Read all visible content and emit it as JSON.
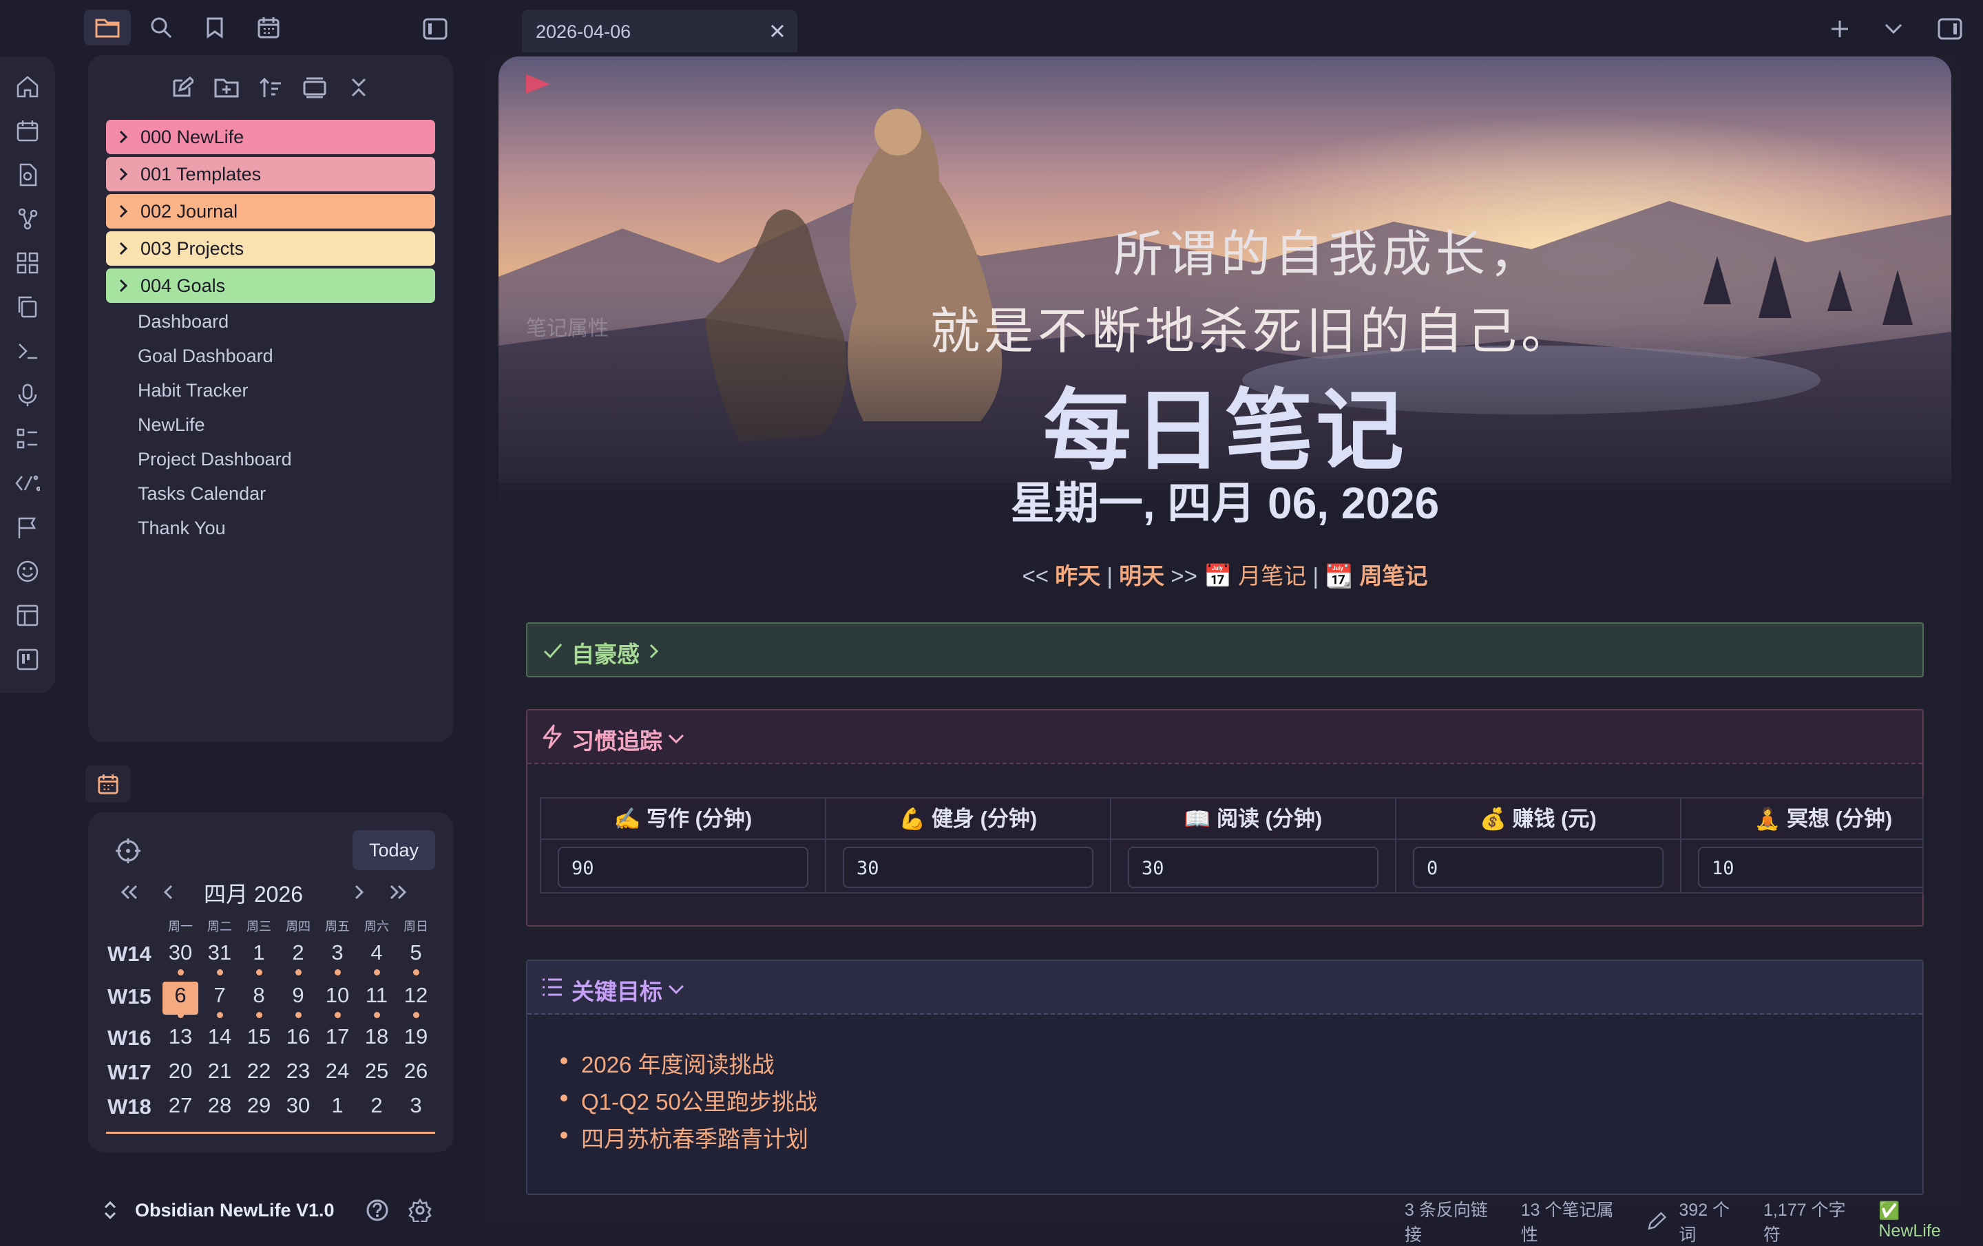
{
  "app": {
    "accent": "#f5a97f",
    "background": "#1d1d2e"
  },
  "tab": {
    "title": "2026-04-06"
  },
  "ribbon": {
    "icons": [
      "home-icon",
      "calendar-icon",
      "search-doc-icon",
      "graph-icon",
      "grid-icon",
      "copy-icon",
      "terminal-icon",
      "mic-icon",
      "list-icon",
      "templater-icon",
      "flag-icon",
      "smile-icon",
      "layout-icon",
      "kanban-icon"
    ]
  },
  "explorer": {
    "folders": [
      {
        "label": "000 NewLife",
        "color": "#f38ba8"
      },
      {
        "label": "001 Templates",
        "color": "#eba0ac"
      },
      {
        "label": "002 Journal",
        "color": "#fab387"
      },
      {
        "label": "003 Projects",
        "color": "#f9e2af"
      },
      {
        "label": "004 Goals",
        "color": "#a6e3a1"
      }
    ],
    "files": [
      "Dashboard",
      "Goal Dashboard",
      "Habit Tracker",
      "NewLife",
      "Project Dashboard",
      "Tasks Calendar",
      "Thank You"
    ]
  },
  "calendar": {
    "today_label": "Today",
    "month_title": "四月 2026",
    "weekdays": [
      "周一",
      "周二",
      "周三",
      "周四",
      "周五",
      "周六",
      "周日"
    ],
    "weeks": [
      {
        "label": "W14",
        "days": [
          "30",
          "31",
          "1",
          "2",
          "3",
          "4",
          "5"
        ]
      },
      {
        "label": "W15",
        "days": [
          "6",
          "7",
          "8",
          "9",
          "10",
          "11",
          "12"
        ]
      },
      {
        "label": "W16",
        "days": [
          "13",
          "14",
          "15",
          "16",
          "17",
          "18",
          "19"
        ]
      },
      {
        "label": "W17",
        "days": [
          "20",
          "21",
          "22",
          "23",
          "24",
          "25",
          "26"
        ]
      },
      {
        "label": "W18",
        "days": [
          "27",
          "28",
          "29",
          "30",
          "1",
          "2",
          "3"
        ]
      }
    ]
  },
  "vault": {
    "name": "Obsidian NewLife V1.0"
  },
  "note": {
    "quote_line1": "所谓的自我成长，",
    "quote_line2": "就是不断地杀死旧的自己。",
    "title": "每日笔记",
    "date": "星期一, 四月 06, 2026",
    "properties_ghost": "笔记属性",
    "nav": {
      "prefix": "<<",
      "yesterday": "昨天",
      "sep": "|",
      "tomorrow": "明天",
      "mid": ">>",
      "month_icon": "📅",
      "month": "月笔记",
      "week_icon": "📆",
      "week": "周笔记"
    },
    "proud": {
      "label": "自豪感"
    },
    "habit": {
      "label": "习惯追踪",
      "columns": [
        {
          "header": "✍️ 写作 (分钟)",
          "value": "90"
        },
        {
          "header": "💪 健身 (分钟)",
          "value": "30"
        },
        {
          "header": "📖 阅读 (分钟)",
          "value": "30"
        },
        {
          "header": "💰 赚钱 (元)",
          "value": "0"
        },
        {
          "header": "🧘 冥想 (分钟)",
          "value": "10"
        }
      ]
    },
    "goals": {
      "label": "关键目标",
      "items": [
        "2026 年度阅读挑战",
        "Q1-Q2 50公里跑步挑战",
        "四月苏杭春季踏青计划"
      ]
    }
  },
  "status": {
    "backlinks": "3 条反向链接",
    "properties": "13 个笔记属性",
    "words": "392 个词",
    "chars": "1,177 个字符",
    "vault": "✅ NewLife"
  }
}
